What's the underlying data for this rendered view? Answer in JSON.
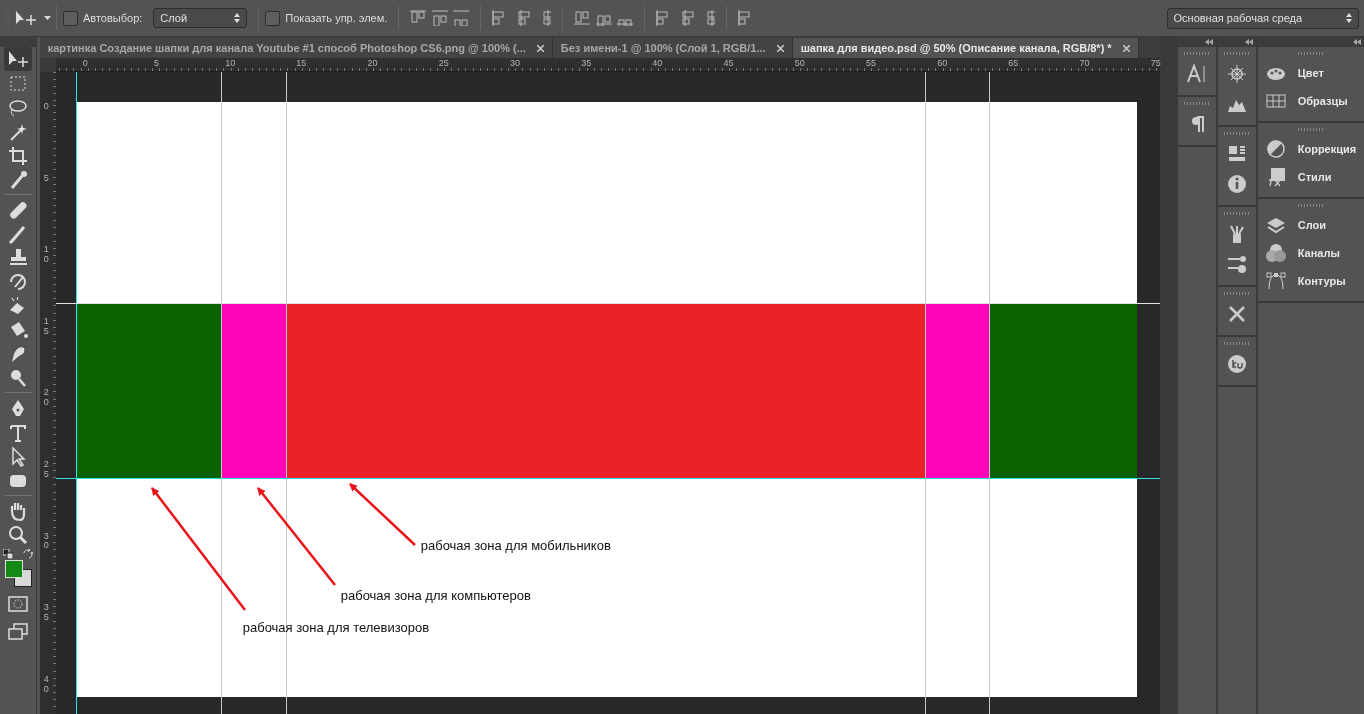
{
  "options_bar": {
    "auto_select": {
      "label": "Автовыбор:",
      "checked": false
    },
    "auto_select_target": "Слой",
    "show_transform_controls": {
      "label": "Показать упр. элем.",
      "checked": false
    },
    "workspace": "Основная рабочая среда"
  },
  "tabs": [
    {
      "label": "картинка Создание шапки для канала Youtube #1 способ Photoshop CS6.png @ 100% (...",
      "selected": false
    },
    {
      "label": "Без имени-1 @ 100% (Слой 1, RGB/1...",
      "selected": false
    },
    {
      "label": "шапка для видео.psd @ 50% (Описание канала, RGB/8*) *",
      "selected": true
    }
  ],
  "rulers": {
    "horizontal": [
      "0",
      "5",
      "10",
      "15",
      "20",
      "25",
      "30",
      "35",
      "40",
      "45",
      "50",
      "55",
      "60",
      "65",
      "70",
      "75"
    ],
    "vertical": [
      "0",
      "5",
      "10",
      "15",
      "20",
      "25",
      "30",
      "35",
      "40"
    ]
  },
  "canvas": {
    "bands": [
      {
        "color": "#0d6200"
      },
      {
        "color": "#ff05b7"
      },
      {
        "color": "#ec2229"
      },
      {
        "color": "#ff05b7"
      },
      {
        "color": "#0d6200"
      }
    ],
    "annotations": [
      "рабочая зона для мобильников",
      "рабочая зона для компьютеров",
      "рабочая зона для телевизоров"
    ]
  },
  "panels": {
    "groups": [
      {
        "items": [
          {
            "label": "Цвет"
          },
          {
            "label": "Образцы"
          }
        ]
      },
      {
        "items": [
          {
            "label": "Коррекция"
          },
          {
            "label": "Стили"
          }
        ]
      },
      {
        "items": [
          {
            "label": "Слои"
          },
          {
            "label": "Каналы"
          },
          {
            "label": "Контуры"
          }
        ]
      }
    ]
  }
}
